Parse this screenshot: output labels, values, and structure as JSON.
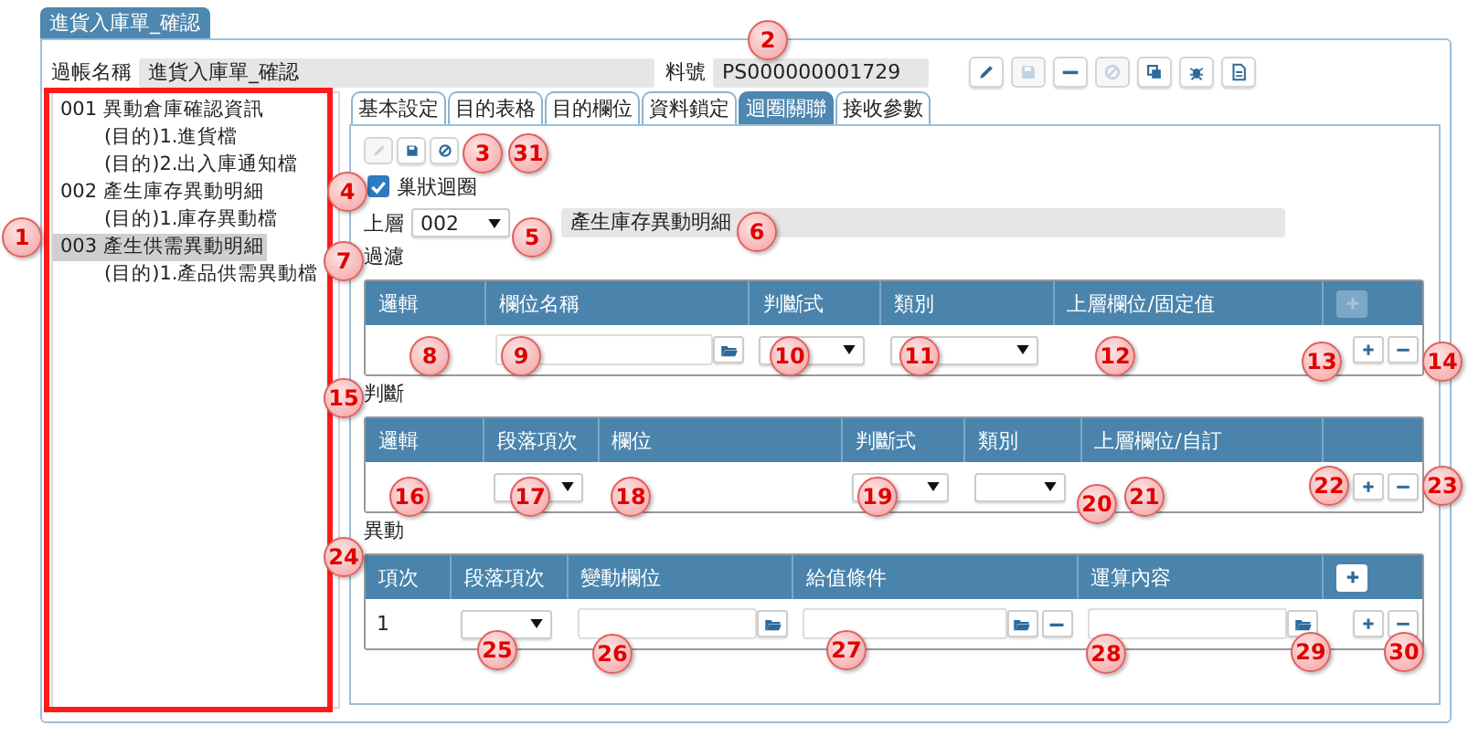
{
  "window": {
    "title": "進貨入庫單_確認"
  },
  "header": {
    "posting_name_label": "過帳名稱",
    "posting_name": "進貨入庫單_確認",
    "item_no_label": "料號",
    "item_no": "PS000000001729"
  },
  "toolbar": [
    {
      "kind": "pencil",
      "disabled": false
    },
    {
      "kind": "save",
      "disabled": true
    },
    {
      "kind": "minus",
      "disabled": false
    },
    {
      "kind": "cancel",
      "disabled": true
    },
    {
      "kind": "copy",
      "disabled": false
    },
    {
      "kind": "bug",
      "disabled": false
    },
    {
      "kind": "document",
      "disabled": false
    }
  ],
  "tree": [
    {
      "label": "001 異動倉庫確認資訊",
      "selected": false,
      "children": [
        {
          "label": "(目的)1.進貨檔",
          "selected": false
        },
        {
          "label": "(目的)2.出入庫通知檔",
          "selected": false
        }
      ]
    },
    {
      "label": "002 產生庫存異動明細",
      "selected": false,
      "children": [
        {
          "label": "(目的)1.庫存異動檔",
          "selected": false
        }
      ]
    },
    {
      "label": "003 產生供需異動明細",
      "selected": true,
      "children": [
        {
          "label": "(目的)1.產品供需異動檔",
          "selected": false
        }
      ]
    }
  ],
  "tabs": [
    {
      "label": "基本設定",
      "selected": false
    },
    {
      "label": "目的表格",
      "selected": false
    },
    {
      "label": "目的欄位",
      "selected": false
    },
    {
      "label": "資料鎖定",
      "selected": false
    },
    {
      "label": "迴圈關聯",
      "selected": true
    },
    {
      "label": "接收參數",
      "selected": false
    }
  ],
  "sub_toolbar": [
    {
      "kind": "pencil",
      "disabled": true
    },
    {
      "kind": "save",
      "disabled": false
    },
    {
      "kind": "cancel",
      "disabled": false
    }
  ],
  "nested_loop": {
    "label": "巢狀迴圈",
    "checked": true
  },
  "parent": {
    "label": "上層",
    "value": "002",
    "name": "產生庫存異動明細"
  },
  "sections": [
    {
      "title": "過濾",
      "columns": [
        {
          "label": "邏輯"
        },
        {
          "label": "欄位名稱"
        },
        {
          "label": "判斷式"
        },
        {
          "label": "類別"
        },
        {
          "label": "上層欄位/固定值"
        },
        {
          "kind": "add",
          "disabled": true
        }
      ],
      "row": [
        {
          "kind": "empty"
        },
        {
          "kind": "picker"
        },
        {
          "kind": "select"
        },
        {
          "kind": "select"
        },
        {
          "kind": "empty"
        },
        {
          "kind": "add-remove"
        }
      ]
    },
    {
      "title": "判斷",
      "columns": [
        {
          "label": "邏輯"
        },
        {
          "label": "段落項次"
        },
        {
          "label": "欄位"
        },
        {
          "label": "判斷式"
        },
        {
          "label": "類別"
        },
        {
          "label": "上層欄位/自訂"
        },
        {
          "kind": "blank"
        }
      ],
      "row": [
        {
          "kind": "empty"
        },
        {
          "kind": "select"
        },
        {
          "kind": "empty"
        },
        {
          "kind": "select"
        },
        {
          "kind": "select"
        },
        {
          "kind": "empty"
        },
        {
          "kind": "add-remove"
        }
      ]
    },
    {
      "title": "異動",
      "columns": [
        {
          "label": "項次"
        },
        {
          "label": "段落項次"
        },
        {
          "label": "變動欄位"
        },
        {
          "label": "給值條件"
        },
        {
          "label": "運算內容"
        },
        {
          "kind": "add",
          "disabled": false
        }
      ],
      "row": [
        {
          "kind": "text",
          "value": "1"
        },
        {
          "kind": "select"
        },
        {
          "kind": "picker"
        },
        {
          "kind": "picker-remove"
        },
        {
          "kind": "picker"
        },
        {
          "kind": "add-remove"
        }
      ]
    }
  ],
  "callouts": [
    "1",
    "2",
    "3",
    "4",
    "5",
    "6",
    "7",
    "8",
    "9",
    "10",
    "11",
    "12",
    "13",
    "14",
    "15",
    "16",
    "17",
    "18",
    "19",
    "20",
    "21",
    "22",
    "23",
    "24",
    "25",
    "26",
    "27",
    "28",
    "29",
    "30",
    "31"
  ]
}
